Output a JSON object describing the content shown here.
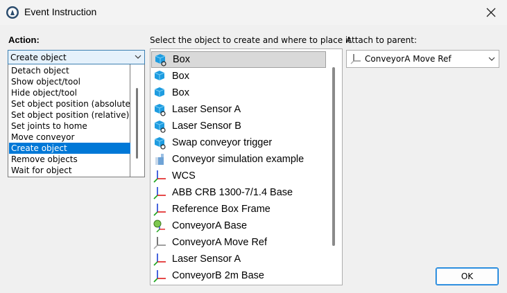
{
  "window": {
    "title": "Event Instruction"
  },
  "action": {
    "label": "Action:",
    "selected": "Create object",
    "options": [
      "Detach object",
      "Show object/tool",
      "Hide object/tool",
      "Set object position (absolute)",
      "Set object position (relative)",
      "Set joints to home",
      "Move conveyor",
      "Create object",
      "Remove objects",
      "Wait for object"
    ],
    "highlighted_index": 7
  },
  "objects": {
    "label": "Select the object to create and where to place it",
    "items": [
      {
        "label": "Box",
        "icon": "box-frame-icon"
      },
      {
        "label": "Box",
        "icon": "box-icon"
      },
      {
        "label": "Box",
        "icon": "box-icon"
      },
      {
        "label": "Laser Sensor A",
        "icon": "box-frame-icon"
      },
      {
        "label": "Laser Sensor B",
        "icon": "box-frame-icon"
      },
      {
        "label": "Swap conveyor trigger",
        "icon": "box-frame-icon"
      },
      {
        "label": "Conveyor simulation example",
        "icon": "station-icon"
      },
      {
        "label": "WCS",
        "icon": "frame-icon"
      },
      {
        "label": "ABB CRB 1300-7/1.4 Base",
        "icon": "frame-icon"
      },
      {
        "label": "Reference Box Frame",
        "icon": "frame-icon"
      },
      {
        "label": "ConveyorA Base",
        "icon": "conveyor-base-icon"
      },
      {
        "label": "ConveyorA Move Ref",
        "icon": "gray-frame-icon"
      },
      {
        "label": "Laser Sensor A",
        "icon": "frame-icon"
      },
      {
        "label": "ConveyorB 2m Base",
        "icon": "frame-icon"
      }
    ],
    "selected_index": 0
  },
  "parent": {
    "label": "Attach to parent:",
    "value": "ConveyorA Move Ref"
  },
  "buttons": {
    "ok": "OK"
  },
  "colors": {
    "accent": "#0078d7",
    "highlight": "#0078d7",
    "selection": "#d9d9d9"
  }
}
